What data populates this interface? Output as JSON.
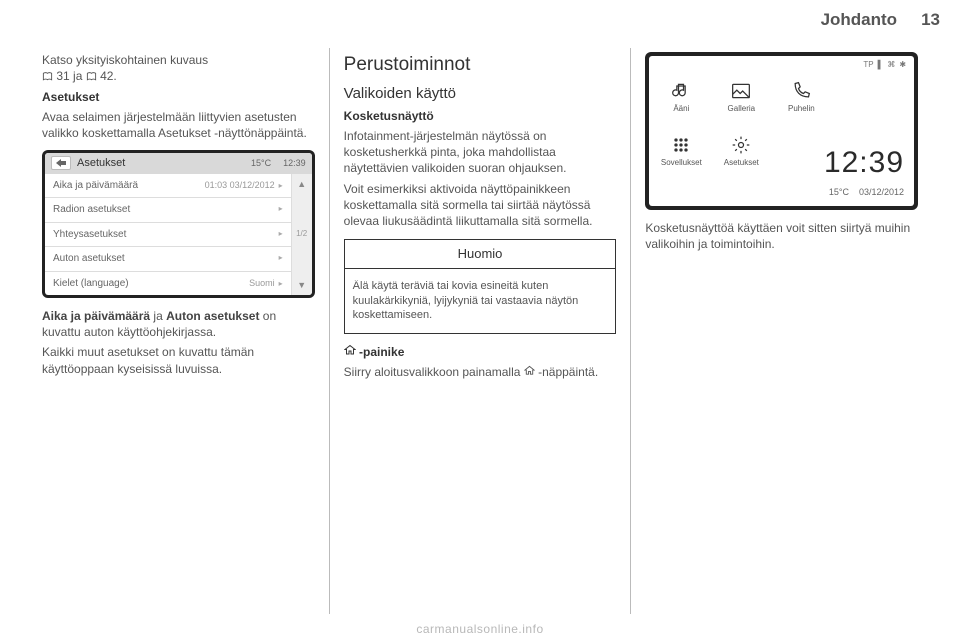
{
  "header": {
    "chapter": "Johdanto",
    "page_number": "13"
  },
  "col1": {
    "intro_text_a": "Katso yksityiskohtainen kuvaus",
    "intro_ref1": "31",
    "intro_text_b": "ja",
    "intro_ref2": "42.",
    "subhead": "Asetukset",
    "para1": "Avaa selaimen järjestelmään liittyvien asetusten valikko koskettamalla Asetukset -näyttönäppäintä.",
    "screenshot": {
      "title": "Asetukset",
      "temp": "15°C",
      "time": "12:39",
      "page_indicator": "1/2",
      "rows": [
        {
          "label": "Aika ja päivämäärä",
          "value": "01:03  03/12/2012"
        },
        {
          "label": "Radion asetukset",
          "value": ""
        },
        {
          "label": "Yhteysasetukset",
          "value": ""
        },
        {
          "label": "Auton asetukset",
          "value": ""
        },
        {
          "label": "Kielet (language)",
          "value": "Suomi"
        }
      ]
    },
    "para2_a": "Aika ja päivämäärä",
    "para2_b": " ja ",
    "para2_c": "Auton asetukset",
    "para2_d": " on kuvattu auton käyttöohjekirjassa.",
    "para3": "Kaikki muut asetukset on kuvattu tämän käyttöoppaan kyseisissä luvuissa."
  },
  "col2": {
    "h2": "Perustoiminnot",
    "h3": "Valikoiden käyttö",
    "h4a": "Kosketusnäyttö",
    "para1": "Infotainment-järjestelmän näytössä on kosketusherkkä pinta, joka mahdollistaa näytettävien valikoiden suoran ohjauksen.",
    "para2": "Voit esimerkiksi aktivoida näyttöpainikkeen koskettamalla sitä sormella tai siirtää näytössä olevaa liukusäädintä liikuttamalla sitä sormella.",
    "notice_title": "Huomio",
    "notice_body": "Älä käytä teräviä tai kovia esineitä kuten kuulakärkikyniä, lyijykyniä tai vastaavia näytön koskettamiseen.",
    "h4b_icon_label": "-painike",
    "para3_a": "Siirry aloitusvalikkoon painamalla ",
    "para3_b": " -näppäintä."
  },
  "col3": {
    "screenshot": {
      "status_items": [
        "TP",
        "▌",
        "⌘",
        "✱"
      ],
      "tiles": [
        {
          "name": "audio-tile",
          "icon": "note",
          "label": "Ääni"
        },
        {
          "name": "gallery-tile",
          "icon": "photo",
          "label": "Galleria"
        },
        {
          "name": "phone-tile",
          "icon": "phone",
          "label": "Puhelin"
        },
        {
          "name": "apps-tile",
          "icon": "grid",
          "label": "Sovellukset"
        },
        {
          "name": "settings-tile",
          "icon": "gear",
          "label": "Asetukset"
        }
      ],
      "clock": "12:39",
      "temp": "15°C",
      "date": "03/12/2012"
    },
    "para1": "Kosketusnäyttöä käyttäen voit sitten siirtyä muihin valikoihin ja toimintoihin."
  },
  "watermark": "carmanualsonline.info"
}
